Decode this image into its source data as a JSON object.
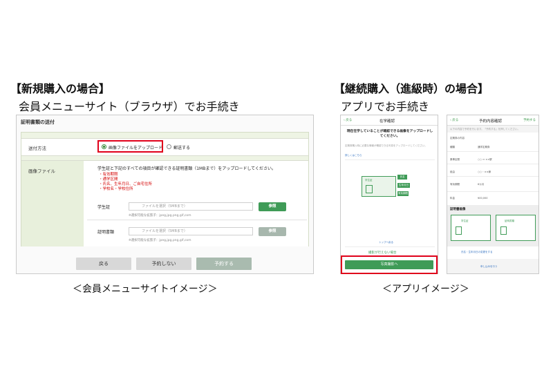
{
  "headings": {
    "new": "【新規購入の場合】",
    "renew": "【継続購入（進級時）の場合】"
  },
  "subheadings": {
    "browser": "会員メニューサイト（ブラウザ）でお手続き",
    "app": "アプリでお手続き"
  },
  "captions": {
    "browser": "＜会員メニューサイトイメージ＞",
    "app": "＜アプリイメージ＞"
  },
  "browser": {
    "section_title": "証明書類の送付",
    "send_method_label": "送付方法",
    "options": [
      "画像ファイルをアップロード",
      "郵送する"
    ],
    "selected_option": "画像ファイルをアップロード",
    "image_file_label": "画像ファイル",
    "instruction": "学生証と下記のすべての項目が確認できる証明書類（1MBまで）をアップロードしてください。",
    "required_items": [
      "・有効期限",
      "・通学区間",
      "・氏名、生年月日、ご自宅住所",
      "・学校名・学校住所"
    ],
    "student_id_label": "学生証",
    "certificate_label": "証明書類",
    "file_placeholder_1": "ファイルを選択（5MBまで）",
    "file_placeholder_2": "ファイルを選択（5MBまで）",
    "ref_button": "参照",
    "extensions_note": "※選択可能な拡張子：jpeg,jpg,png,gif,com",
    "buttons": {
      "back": "戻る",
      "no_reserve": "予約しない",
      "reserve": "予約する"
    }
  },
  "app1": {
    "back": "戻る",
    "title": "在学確認",
    "message": "現在在学していることが確認できる画像をアップロードしてください。",
    "info_text": "定期券購入時に必要な情報が確認できる写真をアップロードしてください。",
    "detail_link": "詳しくはこちら",
    "card_label": "学生証",
    "tags": [
      "氏名",
      "生年月日",
      "有効期限"
    ],
    "top_link": "トップへ戻る",
    "cannot_shoot": "撮影が行えない場合",
    "shoot_button": "写真撮影へ"
  },
  "app2": {
    "back": "戻る",
    "title": "予約内容確認",
    "next": "予約する",
    "note": "以下の内容で予約を行います。「予約する」を押してください。",
    "section": "定期券の内容",
    "rows": [
      {
        "label": "種類",
        "value": "通学定期券"
      },
      {
        "label": "乗車区間",
        "value": "○○ ⇔ ××駅"
      },
      {
        "label": "経由",
        "value": "○○・××線"
      },
      {
        "label": "有効期間",
        "value": "6カ月"
      },
      {
        "label": "料金",
        "value": "¥00,000"
      }
    ],
    "cert_section": "証明書画像",
    "card_labels": [
      "学生証",
      "証明書類"
    ],
    "bottom_link": "氏名・生年月日の変更をする",
    "confirm_button": "申し込みを行う"
  },
  "colors": {
    "accent_green": "#3f9b57",
    "highlight_red": "#e0001a",
    "required_red": "#d40000"
  }
}
